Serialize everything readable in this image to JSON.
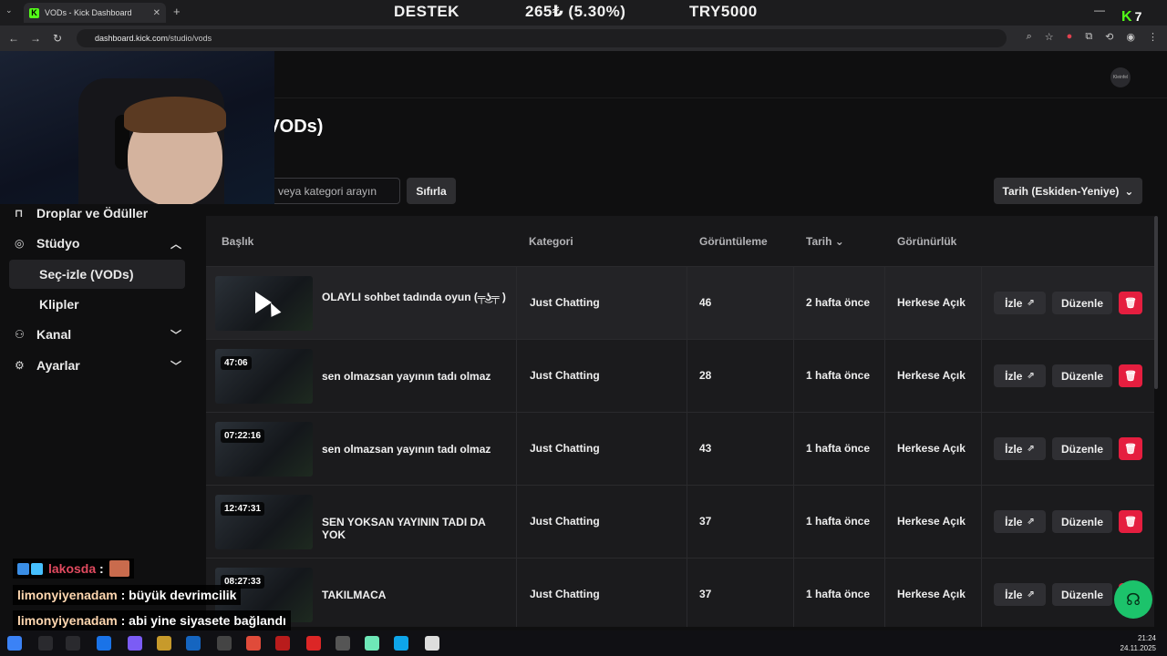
{
  "browser": {
    "tab_title": "VODs - Kick Dashboard",
    "tab_favicon": "K",
    "url_host": "dashboard.kick.com",
    "url_path": "/studio/vods",
    "tickers": [
      "DESTEK",
      "265₺ (5.30%)",
      "TRY5000"
    ],
    "badge_letter": "K",
    "badge_count": "7"
  },
  "page": {
    "title_visible": "e (VODs)",
    "search_placeholder": "veya kategori arayın",
    "reset_label": "Sıfırla",
    "sort_label": "Tarih (Eskiden-Yeniye)",
    "top_avatar_label": "Kleinfel"
  },
  "sidebar": {
    "items": [
      {
        "label": "Droplar ve Ödüller",
        "icon": "gift-icon"
      },
      {
        "label": "Stüdyo",
        "icon": "studio-icon",
        "chevron": "up"
      },
      {
        "label": "Seç-izle (VODs)",
        "active": true
      },
      {
        "label": "Klipler"
      },
      {
        "label": "Kanal",
        "icon": "users-icon",
        "chevron": "down"
      },
      {
        "label": "Ayarlar",
        "icon": "gear-icon",
        "chevron": "down"
      }
    ]
  },
  "table": {
    "headers": {
      "title": "Başlık",
      "category": "Kategori",
      "views": "Görüntüleme",
      "date": "Tarih",
      "visibility": "Görünürlük"
    },
    "watch_label": "İzle",
    "edit_label": "Düzenle",
    "rows": [
      {
        "duration": "",
        "title": "OLAYLI sohbet tadında oyun (╤͜ʖ╤ )",
        "category": "Just Chatting",
        "views": "46",
        "date": "2 hafta önce",
        "visibility": "Herkese Açık"
      },
      {
        "duration": "47:06",
        "title": "sen olmazsan yayının tadı olmaz",
        "category": "Just Chatting",
        "views": "28",
        "date": "1 hafta önce",
        "visibility": "Herkese Açık"
      },
      {
        "duration": "07:22:16",
        "title": "sen olmazsan yayının tadı olmaz",
        "category": "Just Chatting",
        "views": "43",
        "date": "1 hafta önce",
        "visibility": "Herkese Açık"
      },
      {
        "duration": "12:47:31",
        "title": "SEN YOKSAN YAYININ TADI DA YOK",
        "category": "Just Chatting",
        "views": "37",
        "date": "1 hafta önce",
        "visibility": "Herkese Açık"
      },
      {
        "duration": "08:27:33",
        "title": "TAKILMACA",
        "category": "Just Chatting",
        "views": "37",
        "date": "1 hafta önce",
        "visibility": "Herkese Açık"
      }
    ]
  },
  "chat": [
    {
      "user": "lakosda",
      "text": ""
    },
    {
      "user": "limonyiyenadam",
      "text": "büyük devrimcilik"
    },
    {
      "user": "limonyiyenadam",
      "text": "abi yine siyasete bağlandı"
    }
  ],
  "taskbar": {
    "time": "21:24",
    "date": "24.11.2025"
  },
  "colors": {
    "brand": "#53fc18",
    "delete": "#e51e3f",
    "help": "#1cc36b"
  }
}
